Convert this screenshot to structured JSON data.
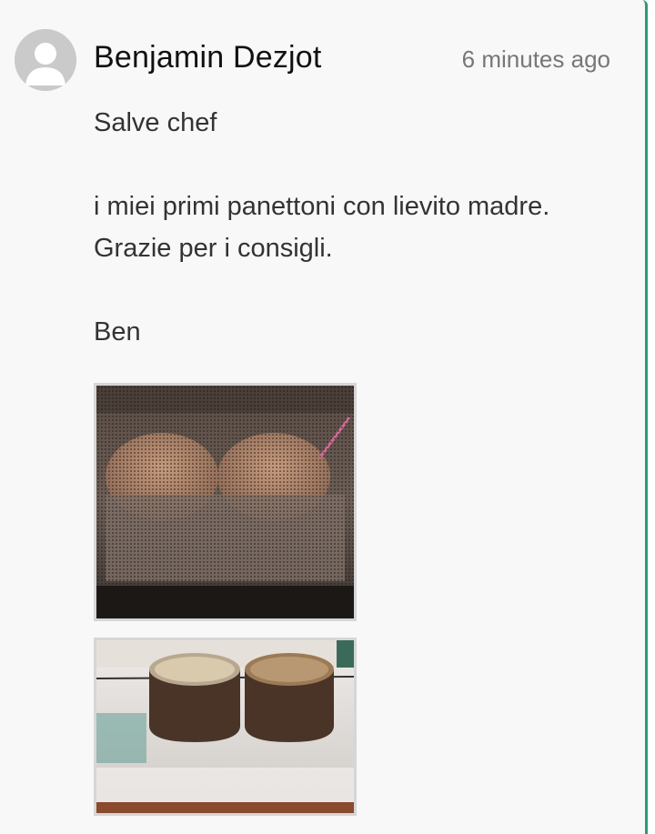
{
  "comment": {
    "author": "Benjamin Dezjot",
    "timestamp": "6 minutes ago",
    "body_lines": {
      "line1": "Salve chef",
      "line2": "i miei primi panettoni con lievito madre.",
      "line3": "Grazie per i consigli.",
      "line4": "Ben"
    },
    "attachments": [
      {
        "name": "panettoni-in-oven-photo"
      },
      {
        "name": "panettoni-cooling-upside-down-photo"
      }
    ]
  },
  "colors": {
    "card_background": "#f8f8f8",
    "accent_border": "#2b9b78",
    "author_text": "#111111",
    "timestamp_text": "#777777",
    "body_text": "#333333"
  }
}
